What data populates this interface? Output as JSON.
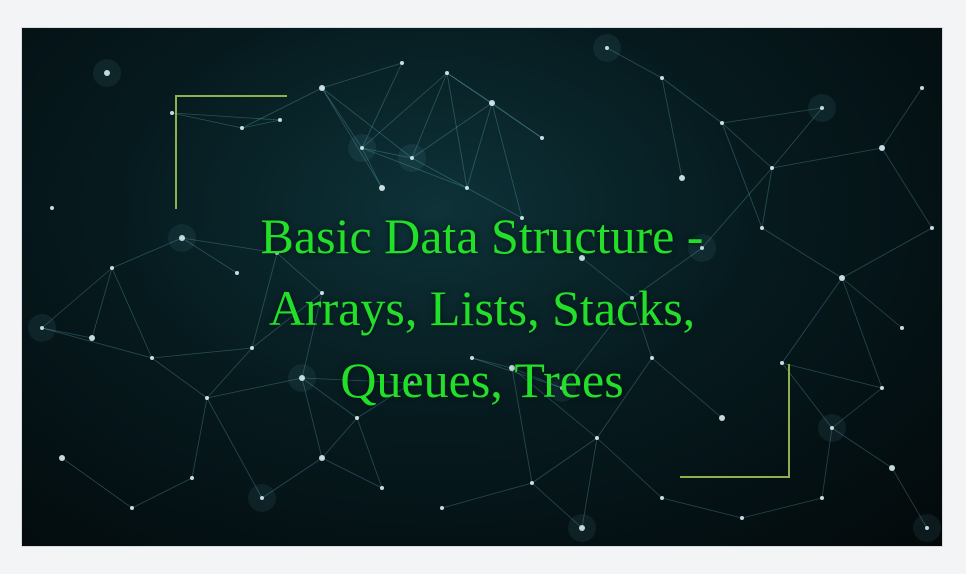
{
  "slide": {
    "title": "Basic Data Structure - Arrays, Lists, Stacks, Queues, Trees"
  },
  "colors": {
    "title_text": "#22e02a",
    "accent_frame": "#8fb04a",
    "background": "#03090b",
    "network": "#7fd6e6"
  },
  "background_image": "network-nodes-graphic"
}
